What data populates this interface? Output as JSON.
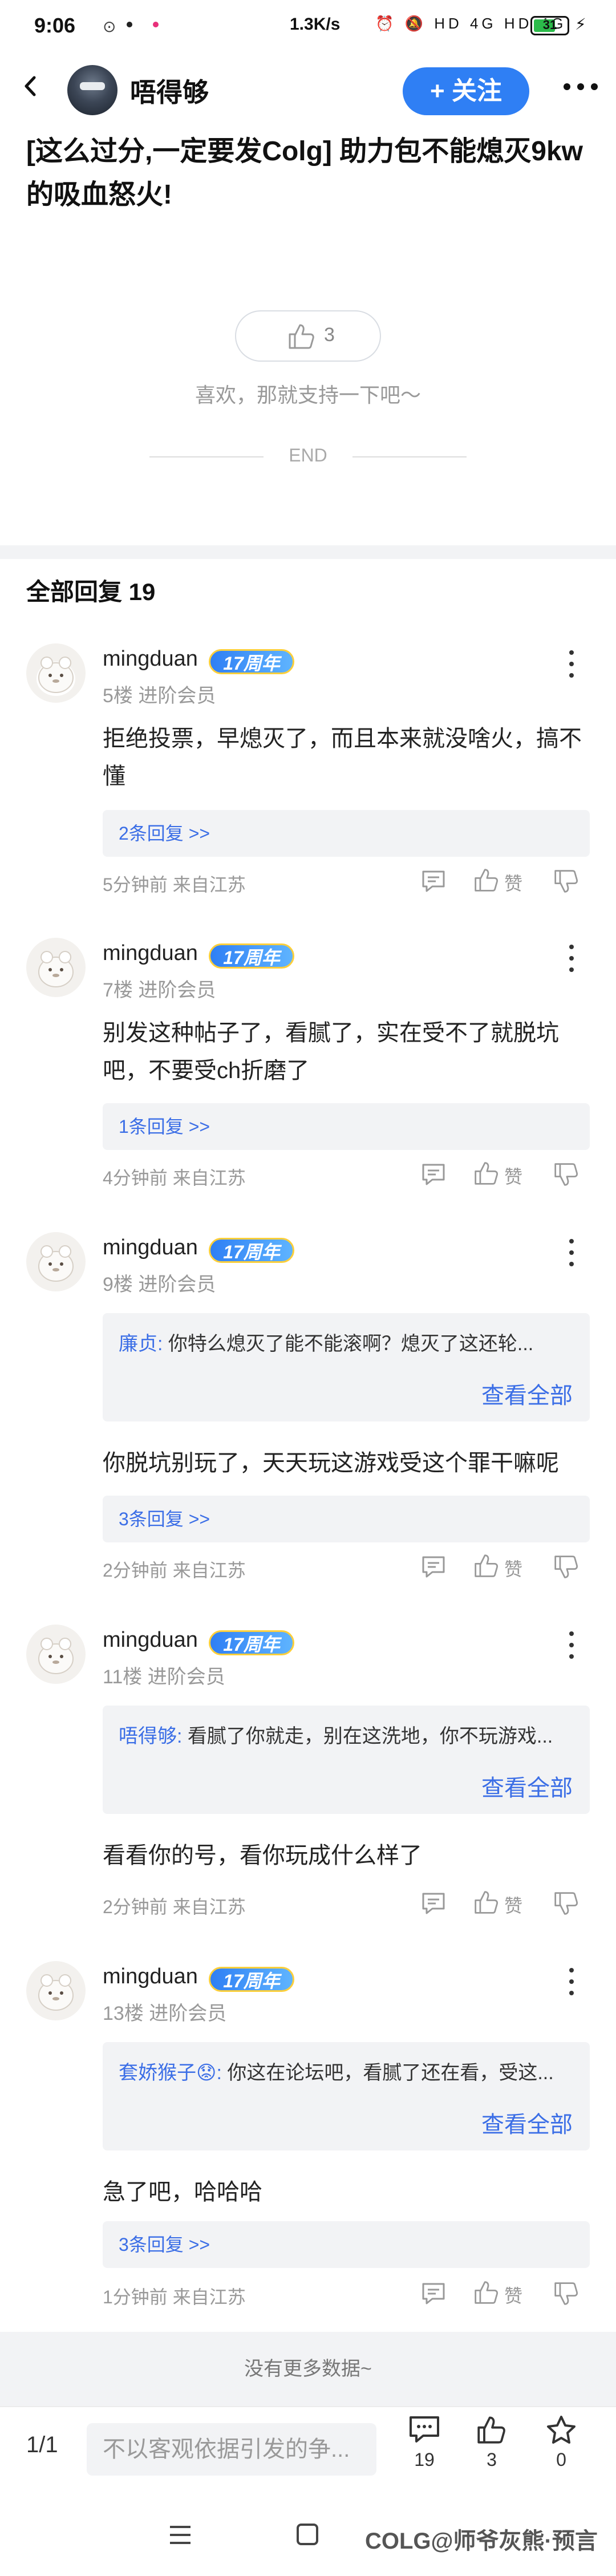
{
  "status_bar": {
    "time": "9:06",
    "net_speed": "1.3K/s",
    "battery": "31",
    "icons": "⏰ 🔕 HD 4G HD 4G"
  },
  "nav": {
    "username": "唔得够",
    "follow_label": "+ 关注"
  },
  "post": {
    "title": "[这么过分,一定要发Colg] 助力包不能熄灭9kw的吸血怒火!",
    "like_count": "3",
    "like_hint": "喜欢，那就支持一下吧～",
    "end_label": "END"
  },
  "comments_header": "全部回复  19",
  "comments": [
    {
      "user": "mingduan",
      "badge": "17周年",
      "floor": "5楼  进阶会员",
      "body": "拒绝投票，早熄灭了，而且本来就没啥火，搞不懂",
      "replies": "2条回复 >>",
      "meta": "5分钟前  来自江苏",
      "like": "赞"
    },
    {
      "user": "mingduan",
      "badge": "17周年",
      "floor": "7楼  进阶会员",
      "body": "别发这种帖子了，看腻了，实在受不了就脱坑吧，不要受ch折磨了",
      "replies": "1条回复 >>",
      "meta": "4分钟前  来自江苏",
      "like": "赞"
    },
    {
      "user": "mingduan",
      "badge": "17周年",
      "floor": "9楼  进阶会员",
      "quote_name": "廉贞:",
      "quote_text": " 你特么熄灭了能不能滚啊？熄灭了这还轮...",
      "view_all": "查看全部",
      "body": "你脱坑别玩了，天天玩这游戏受这个罪干嘛呢",
      "replies": "3条回复 >>",
      "meta": "2分钟前  来自江苏",
      "like": "赞"
    },
    {
      "user": "mingduan",
      "badge": "17周年",
      "floor": "11楼  进阶会员",
      "quote_name": "唔得够:",
      "quote_text": " 看腻了你就走，别在这洗地，你不玩游戏...",
      "view_all": "查看全部",
      "body": "看看你的号，看你玩成什么样了",
      "meta": "2分钟前  来自江苏",
      "like": "赞"
    },
    {
      "user": "mingduan",
      "badge": "17周年",
      "floor": "13楼  进阶会员",
      "quote_name": "套娇猴子😟:",
      "quote_text": " 你这在论坛吧，看腻了还在看，受这...",
      "view_all": "查看全部",
      "body": "急了吧，哈哈哈",
      "replies": "3条回复 >>",
      "meta": "1分钟前  来自江苏",
      "like": "赞"
    }
  ],
  "no_more": "没有更多数据~",
  "bottom_bar": {
    "page": "1/1",
    "input_placeholder": "不以客观依据引发的争...",
    "comment_count": "19",
    "like_count": "3",
    "fav_count": "0"
  },
  "watermark": "COLG@师爷灰熊·预言",
  "colors": {
    "accent": "#2f7ff4",
    "link": "#3b6ee6"
  }
}
